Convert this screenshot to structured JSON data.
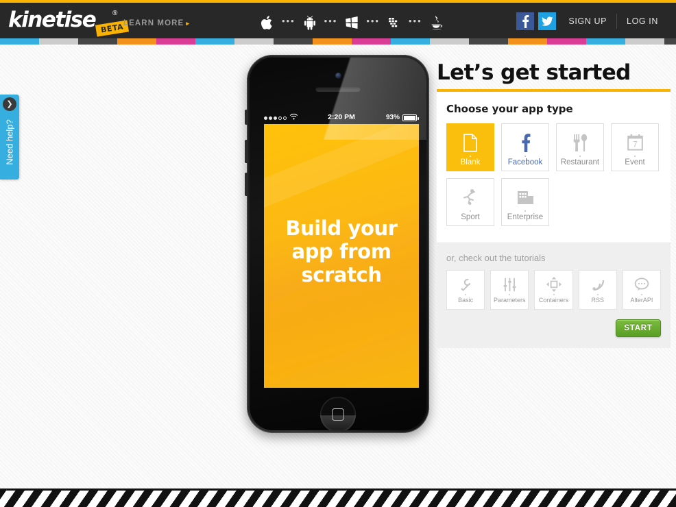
{
  "header": {
    "logo_text": "kinetise",
    "logo_registered": "®",
    "beta_badge": "BETA",
    "learn_more": "LEARN MORE",
    "learn_more_arrow": "▸",
    "platform_icons": [
      "apple-icon",
      "android-icon",
      "windows-icon",
      "blackberry-icon",
      "java-icon"
    ],
    "platform_separator": "•••",
    "social": [
      {
        "name": "facebook-icon",
        "glyph": "f",
        "color": "#3b5998"
      },
      {
        "name": "twitter-icon",
        "glyph": "🐦",
        "color": "#1da1e2"
      }
    ],
    "sign_up": "SIGN UP",
    "log_in": "LOG IN"
  },
  "stripe": {
    "colors": [
      "#36aee0",
      "#cccccc",
      "#464646",
      "#f2911b",
      "#da3d96"
    ],
    "repeat": 4
  },
  "help_tab": {
    "label": "Need help?",
    "arrow": "❯"
  },
  "phone": {
    "status_bar": {
      "signal_dots_filled": 3,
      "signal_dots_total": 5,
      "wifi": "wifi-icon",
      "time": "2:20 PM",
      "battery_percent": "93%"
    },
    "screen": {
      "headline": "Build your app from scratch",
      "background_color": "#fcb813"
    },
    "home_button": "home-button"
  },
  "panel": {
    "title": "Let’s get started",
    "accent_color": "#f9b300",
    "app_type": {
      "heading": "Choose your app type",
      "tiles": [
        {
          "label": "Blank",
          "icon": "document-icon",
          "selected": true
        },
        {
          "label": "Facebook",
          "icon": "facebook-icon",
          "selected": false
        },
        {
          "label": "Restaurant",
          "icon": "cutlery-icon",
          "selected": false
        },
        {
          "label": "Event",
          "icon": "calendar-icon",
          "selected": false
        },
        {
          "label": "Sport",
          "icon": "runner-icon",
          "selected": false
        },
        {
          "label": "Enterprise",
          "icon": "building-icon",
          "selected": false
        }
      ]
    },
    "tutorials": {
      "heading": "or, check out the tutorials",
      "tiles": [
        {
          "label": "Basic",
          "icon": "wrench-icon"
        },
        {
          "label": "Parameters",
          "icon": "sliders-icon"
        },
        {
          "label": "Containers",
          "icon": "move-arrows-icon"
        },
        {
          "label": "RSS",
          "icon": "rss-icon"
        },
        {
          "label": "AlterAPI",
          "icon": "speech-bubble-icon"
        }
      ]
    },
    "start_button": "START"
  }
}
